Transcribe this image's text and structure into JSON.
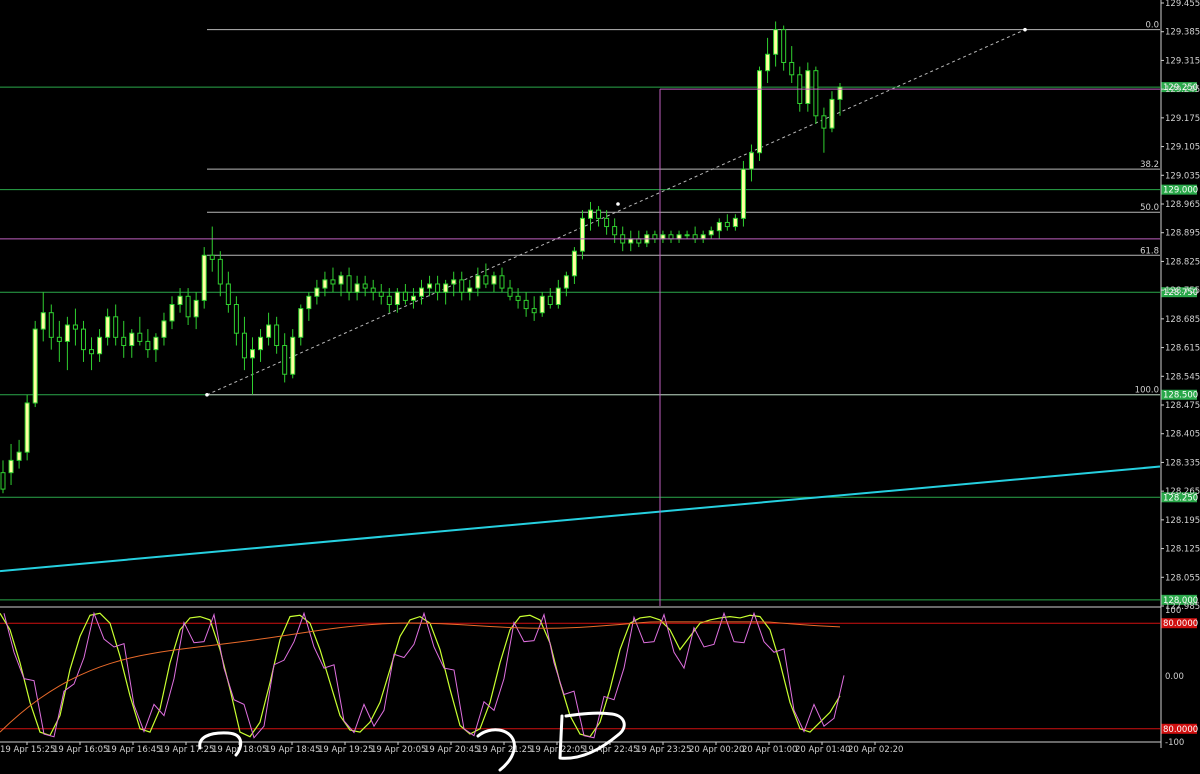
{
  "chart_data": {
    "type": "candlestick",
    "price_axis": {
      "ylim": [
        127.985,
        129.455
      ],
      "ticks": [
        "129.455",
        "129.385",
        "129.315",
        "129.245",
        "129.175",
        "129.105",
        "129.035",
        "128.965",
        "128.895",
        "128.825",
        "128.755",
        "128.685",
        "128.615",
        "128.545",
        "128.475",
        "128.405",
        "128.335",
        "128.265",
        "128.195",
        "128.125",
        "128.055",
        "127.985"
      ]
    },
    "time_axis": {
      "labels": [
        "19 Apr 15:25",
        "19 Apr 16:05",
        "19 Apr 16:45",
        "19 Apr 17:25",
        "19 Apr 18:05",
        "19 Apr 18:45",
        "19 Apr 19:25",
        "19 Apr 20:05",
        "19 Apr 20:45",
        "19 Apr 21:25",
        "19 Apr 22:05",
        "19 Apr 22:45",
        "19 Apr 23:25",
        "20 Apr 00:20",
        "20 Apr 01:00",
        "20 Apr 01:40",
        "20 Apr 02:20"
      ]
    },
    "candles": [
      [
        128.31,
        128.34,
        128.26,
        128.27
      ],
      [
        128.31,
        128.38,
        128.28,
        128.34
      ],
      [
        128.34,
        128.39,
        128.32,
        128.36
      ],
      [
        128.36,
        128.5,
        128.34,
        128.48
      ],
      [
        128.48,
        128.68,
        128.47,
        128.66
      ],
      [
        128.66,
        128.75,
        128.63,
        128.7
      ],
      [
        128.7,
        128.72,
        128.61,
        128.64
      ],
      [
        128.64,
        128.68,
        128.58,
        128.63
      ],
      [
        128.63,
        128.69,
        128.56,
        128.67
      ],
      [
        128.67,
        128.71,
        128.62,
        128.66
      ],
      [
        128.66,
        128.68,
        128.58,
        128.61
      ],
      [
        128.61,
        128.64,
        128.56,
        128.6
      ],
      [
        128.6,
        128.66,
        128.58,
        128.64
      ],
      [
        128.64,
        128.71,
        128.62,
        128.69
      ],
      [
        128.69,
        128.72,
        128.62,
        128.64
      ],
      [
        128.64,
        128.68,
        128.59,
        128.62
      ],
      [
        128.62,
        128.66,
        128.59,
        128.65
      ],
      [
        128.65,
        128.69,
        128.62,
        128.63
      ],
      [
        128.63,
        128.66,
        128.59,
        128.61
      ],
      [
        128.61,
        128.65,
        128.58,
        128.64
      ],
      [
        128.64,
        128.7,
        128.62,
        128.68
      ],
      [
        128.68,
        128.74,
        128.66,
        128.72
      ],
      [
        128.72,
        128.76,
        128.7,
        128.74
      ],
      [
        128.74,
        128.76,
        128.67,
        128.69
      ],
      [
        128.69,
        128.75,
        128.66,
        128.73
      ],
      [
        128.73,
        128.86,
        128.71,
        128.84
      ],
      [
        128.84,
        128.91,
        128.8,
        128.83
      ],
      [
        128.83,
        128.85,
        128.74,
        128.77
      ],
      [
        128.77,
        128.8,
        128.7,
        128.72
      ],
      [
        128.72,
        128.74,
        128.62,
        128.65
      ],
      [
        128.65,
        128.69,
        128.56,
        128.59
      ],
      [
        128.59,
        128.64,
        128.5,
        128.61
      ],
      [
        128.61,
        128.66,
        128.58,
        128.64
      ],
      [
        128.64,
        128.7,
        128.62,
        128.67
      ],
      [
        128.67,
        128.69,
        128.6,
        128.62
      ],
      [
        128.62,
        128.65,
        128.53,
        128.55
      ],
      [
        128.55,
        128.66,
        128.54,
        128.64
      ],
      [
        128.64,
        128.72,
        128.62,
        128.71
      ],
      [
        128.71,
        128.75,
        128.68,
        128.74
      ],
      [
        128.74,
        128.78,
        128.72,
        128.76
      ],
      [
        128.76,
        128.8,
        128.74,
        128.78
      ],
      [
        128.78,
        128.81,
        128.75,
        128.77
      ],
      [
        128.77,
        128.8,
        128.74,
        128.79
      ],
      [
        128.79,
        128.81,
        128.73,
        128.75
      ],
      [
        128.75,
        128.79,
        128.73,
        128.77
      ],
      [
        128.77,
        128.79,
        128.74,
        128.76
      ],
      [
        128.76,
        128.78,
        128.73,
        128.75
      ],
      [
        128.75,
        128.77,
        128.72,
        128.74
      ],
      [
        128.74,
        128.76,
        128.7,
        128.72
      ],
      [
        128.72,
        128.76,
        128.7,
        128.75
      ],
      [
        128.75,
        128.77,
        128.72,
        128.73
      ],
      [
        128.73,
        128.76,
        128.71,
        128.74
      ],
      [
        128.74,
        128.78,
        128.72,
        128.76
      ],
      [
        128.76,
        128.79,
        128.74,
        128.77
      ],
      [
        128.77,
        128.79,
        128.73,
        128.75
      ],
      [
        128.75,
        128.78,
        128.72,
        128.77
      ],
      [
        128.77,
        128.8,
        128.74,
        128.78
      ],
      [
        128.78,
        128.8,
        128.73,
        128.75
      ],
      [
        128.75,
        128.78,
        128.73,
        128.76
      ],
      [
        128.76,
        128.81,
        128.74,
        128.79
      ],
      [
        128.79,
        128.82,
        128.76,
        128.77
      ],
      [
        128.77,
        128.8,
        128.75,
        128.79
      ],
      [
        128.79,
        128.81,
        128.75,
        128.76
      ],
      [
        128.76,
        128.78,
        128.73,
        128.74
      ],
      [
        128.74,
        128.76,
        128.71,
        128.73
      ],
      [
        128.73,
        128.75,
        128.69,
        128.71
      ],
      [
        128.71,
        128.74,
        128.68,
        128.7
      ],
      [
        128.7,
        128.75,
        128.69,
        128.74
      ],
      [
        128.74,
        128.76,
        128.71,
        128.72
      ],
      [
        128.72,
        128.78,
        128.71,
        128.76
      ],
      [
        128.76,
        128.8,
        128.74,
        128.79
      ],
      [
        128.79,
        128.86,
        128.77,
        128.85
      ],
      [
        128.85,
        128.95,
        128.83,
        128.93
      ],
      [
        128.93,
        128.97,
        128.9,
        128.95
      ],
      [
        128.95,
        128.96,
        128.91,
        128.93
      ],
      [
        128.93,
        128.95,
        128.89,
        128.91
      ],
      [
        128.91,
        128.93,
        128.87,
        128.89
      ],
      [
        128.89,
        128.91,
        128.85,
        128.87
      ],
      [
        128.87,
        128.9,
        128.85,
        128.88
      ],
      [
        128.88,
        128.9,
        128.86,
        128.87
      ],
      [
        128.87,
        128.9,
        128.86,
        128.89
      ],
      [
        128.89,
        128.9,
        128.87,
        128.88
      ],
      [
        128.88,
        128.9,
        128.87,
        128.89
      ],
      [
        128.89,
        128.9,
        128.87,
        128.88
      ],
      [
        128.88,
        128.9,
        128.87,
        128.89
      ],
      [
        128.89,
        128.9,
        128.88,
        128.89
      ],
      [
        128.89,
        128.91,
        128.87,
        128.88
      ],
      [
        128.88,
        128.9,
        128.87,
        128.89
      ],
      [
        128.89,
        128.91,
        128.88,
        128.9
      ],
      [
        128.9,
        128.93,
        128.88,
        128.92
      ],
      [
        128.92,
        128.94,
        128.9,
        128.91
      ],
      [
        128.91,
        128.94,
        128.9,
        128.93
      ],
      [
        128.93,
        129.07,
        128.91,
        129.05
      ],
      [
        129.05,
        129.11,
        129.02,
        129.09
      ],
      [
        129.09,
        129.3,
        129.07,
        129.29
      ],
      [
        129.29,
        129.37,
        129.26,
        129.33
      ],
      [
        129.33,
        129.41,
        129.3,
        129.39
      ],
      [
        129.39,
        129.4,
        129.29,
        129.31
      ],
      [
        129.31,
        129.35,
        129.26,
        129.28
      ],
      [
        129.28,
        129.3,
        129.19,
        129.21
      ],
      [
        129.21,
        129.31,
        129.19,
        129.29
      ],
      [
        129.29,
        129.3,
        129.16,
        129.18
      ],
      [
        129.18,
        129.2,
        129.09,
        129.15
      ],
      [
        129.15,
        129.24,
        129.14,
        129.22
      ],
      [
        129.22,
        129.26,
        129.18,
        129.25
      ]
    ],
    "horizontal_levels": [
      "129.250",
      "129.000",
      "128.750",
      "128.500",
      "128.250",
      "128.000"
    ],
    "fibonacci": {
      "levels": [
        "0.0",
        "38.2",
        "50.0",
        "61.8",
        "100.0"
      ],
      "low": 128.5,
      "high": 129.39
    },
    "oscillator": {
      "ticks": [
        "100",
        "0.00",
        "-100"
      ],
      "level_labels": [
        "80.0000",
        "80.0000"
      ]
    }
  },
  "colors": {
    "background": "#000000",
    "bull_candle": "#ffffa0",
    "bear_candle": "#000000",
    "wick": "#30d030",
    "axis_line": "#d0d0d0",
    "green_level": "#2aa84a",
    "tag_green_bg": "#2aa84a",
    "tag_red_bg": "#d01010",
    "fib": "#b8b8b8",
    "trendline": "#26d0e0",
    "crosshair": "#c060c0",
    "osc_main": "#c8ff30",
    "osc_signal": "#e070e0",
    "osc_slow": "#e86a2a",
    "osc_level": "#d01010",
    "marker": "#ffffff"
  }
}
